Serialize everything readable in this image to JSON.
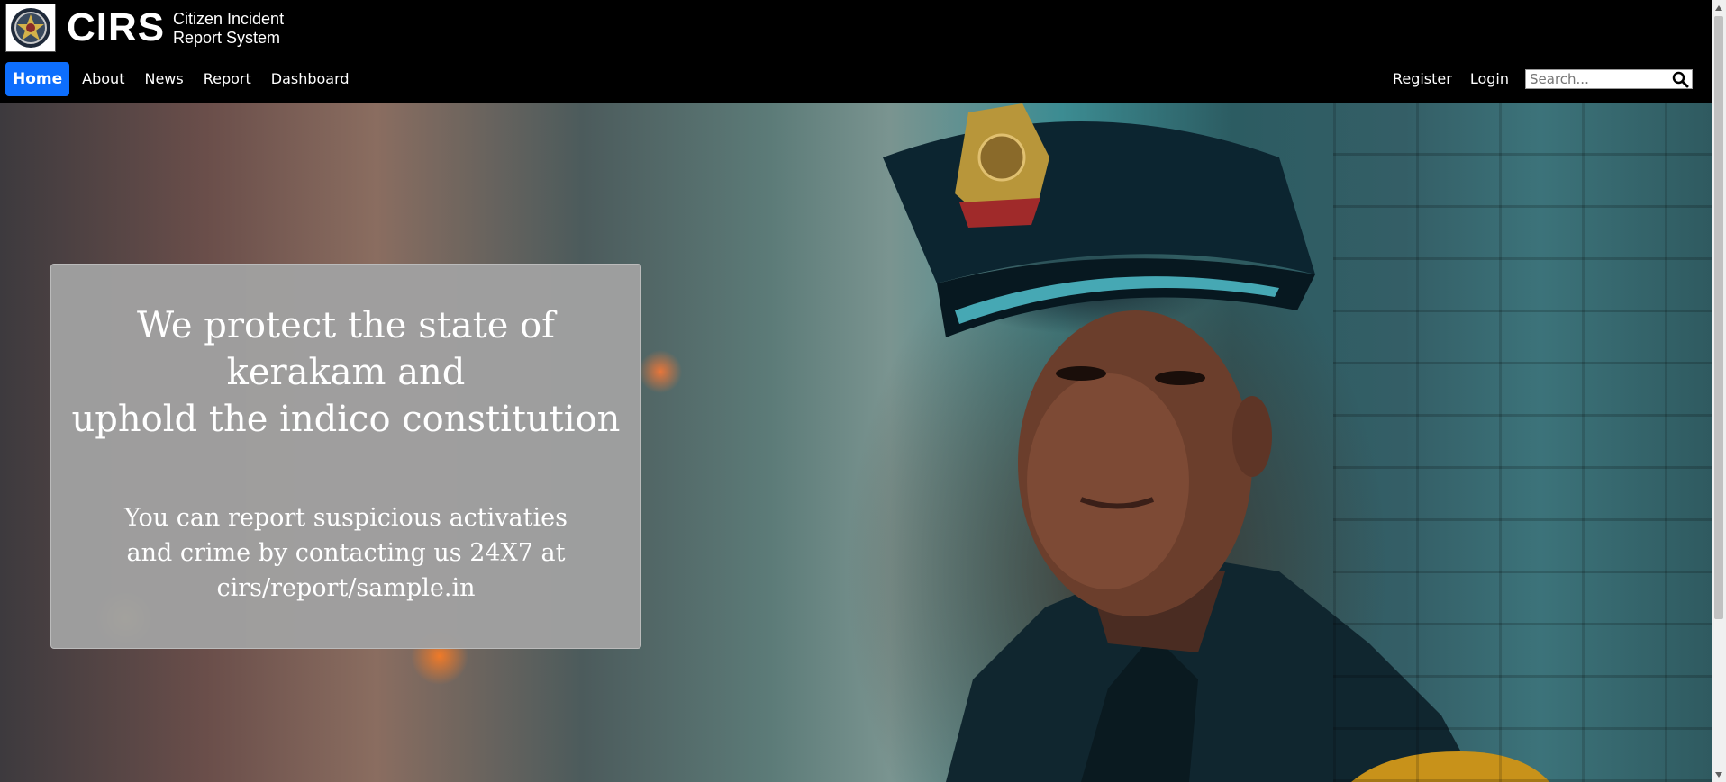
{
  "header": {
    "brand": "CIRS",
    "subtitle": "Citizen Incident\nReport System",
    "logo_icon": "police-badge-icon"
  },
  "nav": {
    "items": [
      {
        "label": "Home",
        "active": true
      },
      {
        "label": "About"
      },
      {
        "label": "News"
      },
      {
        "label": "Report"
      },
      {
        "label": "Dashboard"
      }
    ],
    "right": {
      "register_label": "Register",
      "login_label": "Login",
      "search_placeholder": "Search...",
      "search_icon": "search-icon"
    }
  },
  "hero": {
    "title": "We protect the state of\nkerakam and\nuphold the indico constitution",
    "text": "You can report suspicious activaties\nand crime by contacting us 24X7 at\ncirs/report/sample.in",
    "background_image": "police-officer-photo"
  },
  "colors": {
    "header_bg": "#000000",
    "active_nav_bg": "#0d6efd",
    "card_bg": "#a0a0a0"
  }
}
